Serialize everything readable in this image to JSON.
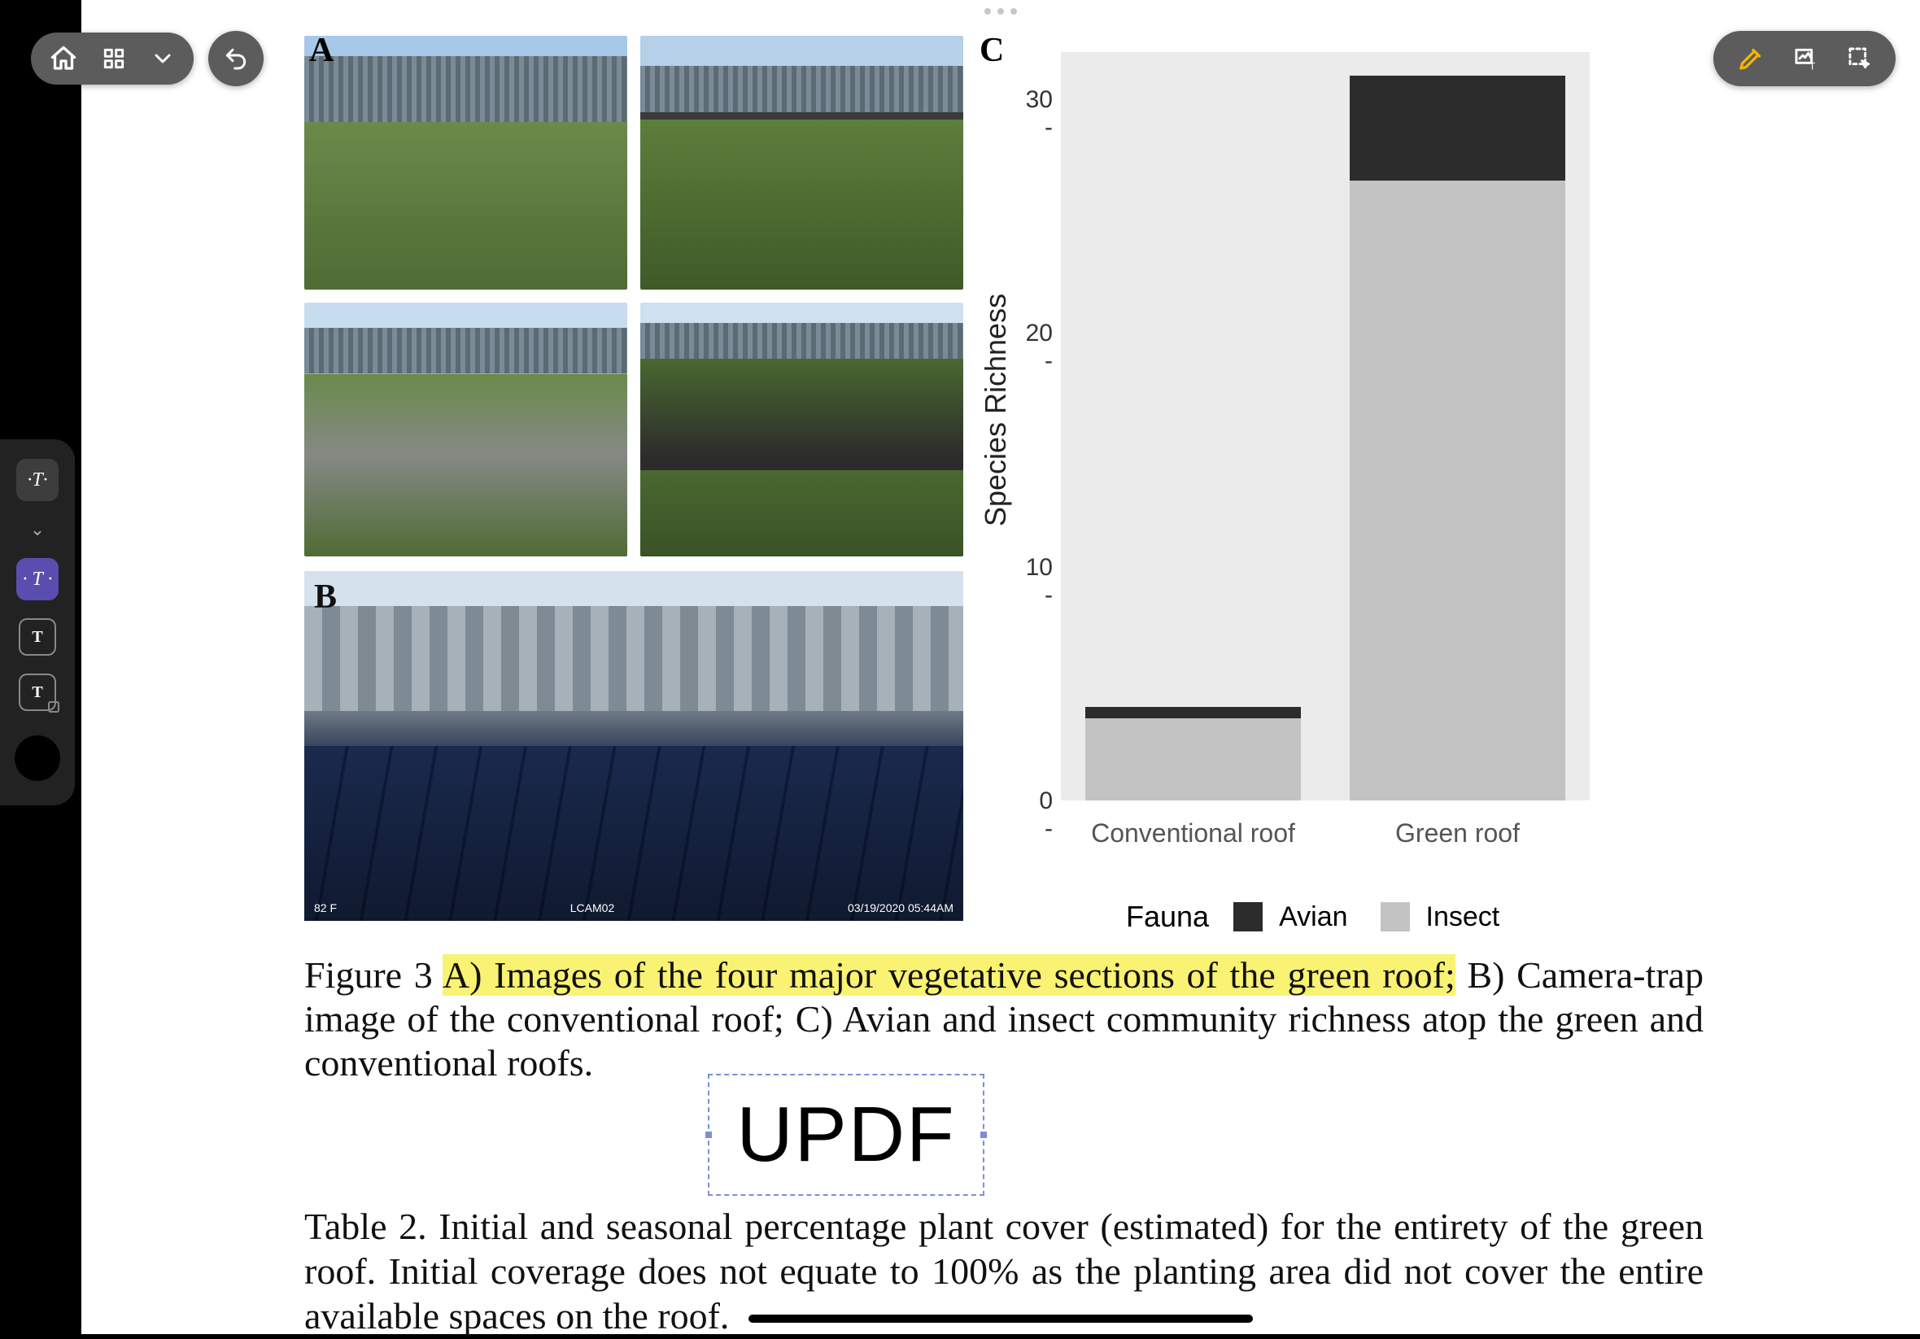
{
  "toolbar": {
    "home_icon": "home-icon",
    "grid_icon": "grid-icon",
    "dropdown_icon": "chevron-down-icon",
    "undo_icon": "undo-icon",
    "highlight_icon": "highlighter-icon",
    "ocr_icon": "image-text-icon",
    "select_icon": "selection-icon"
  },
  "sidebar": {
    "items": [
      {
        "label": "T",
        "kind": "raised"
      },
      {
        "label": "⌄",
        "kind": "chevron"
      },
      {
        "label": "T",
        "kind": "active"
      },
      {
        "label": "T",
        "kind": "outline"
      },
      {
        "label": "T",
        "kind": "outline-sub"
      }
    ]
  },
  "figure": {
    "panel_a": "A",
    "panel_b": "B",
    "panel_c": "C",
    "trap_left": "82 F",
    "trap_mid": "LCAM02",
    "trap_right": "03/19/2020 05:44AM"
  },
  "caption": {
    "prefix": "Figure 3 ",
    "highlight": "A) Images of the four major vegetative sections of the green roof;",
    "rest": " B) Camera-trap image of the conventional roof; C) Avian and insect community richness atop the green and conventional roofs."
  },
  "textbox": {
    "value": "UPDF"
  },
  "caption2": "Table 2. Initial and seasonal percentage plant cover (estimated) for the entirety of the green roof. Initial coverage does not equate to 100% as the planting area did not cover the entire available spaces on the roof.",
  "chart_data": {
    "type": "bar",
    "stacked": true,
    "ylabel": "Species Richness",
    "ylim": [
      0,
      32
    ],
    "yticks": [
      0,
      10,
      20,
      30
    ],
    "categories": [
      "Conventional  roof",
      "Green  roof"
    ],
    "series": [
      {
        "name": "Avian",
        "values": [
          0.5,
          4.5
        ],
        "color": "#2c2c2c"
      },
      {
        "name": "Insect",
        "values": [
          3.5,
          26.5
        ],
        "color": "#c3c3c3"
      }
    ],
    "legend_title": "Fauna"
  }
}
